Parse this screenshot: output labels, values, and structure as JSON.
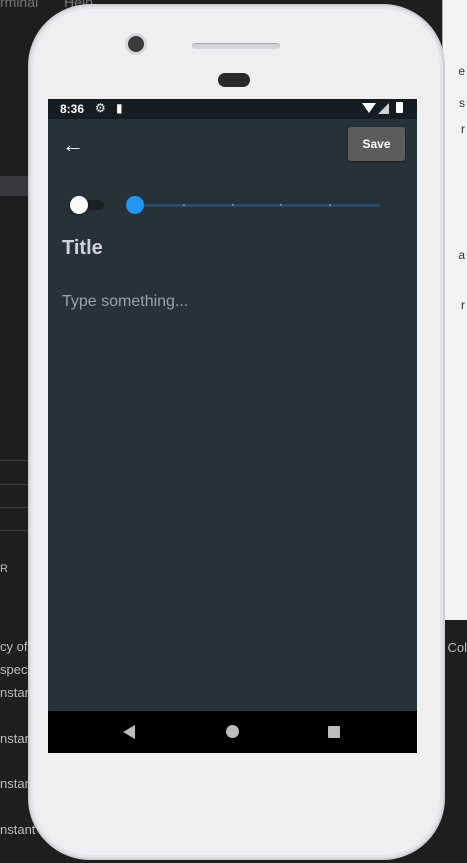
{
  "ide": {
    "menu": [
      "rminal",
      "Help"
    ],
    "left_snippets": [
      "R",
      "cy of",
      "spec",
      "nstar",
      "nstar",
      "nstar",
      "nstant"
    ],
    "right_snippets": [
      "e",
      "s",
      "r",
      "a",
      "r"
    ],
    "bottom_right": ", Col"
  },
  "status_bar": {
    "time": "8:36",
    "icons": [
      "gear-icon",
      "sd-card-icon",
      "wifi-icon",
      "cell-signal-icon",
      "battery-icon"
    ]
  },
  "toolbar": {
    "back_icon": "arrow-left-icon",
    "save_label": "Save"
  },
  "controls": {
    "switch_on": false,
    "slider_value": 0,
    "accent_color": "#2196f3"
  },
  "editor": {
    "title_placeholder": "Title",
    "body_placeholder": "Type something..."
  },
  "nav_bar": {
    "buttons": [
      "back-triangle-icon",
      "home-circle-icon",
      "recents-square-icon"
    ]
  },
  "colors": {
    "screen_bg": "#263238",
    "save_button_bg": "#5c5c5c"
  }
}
